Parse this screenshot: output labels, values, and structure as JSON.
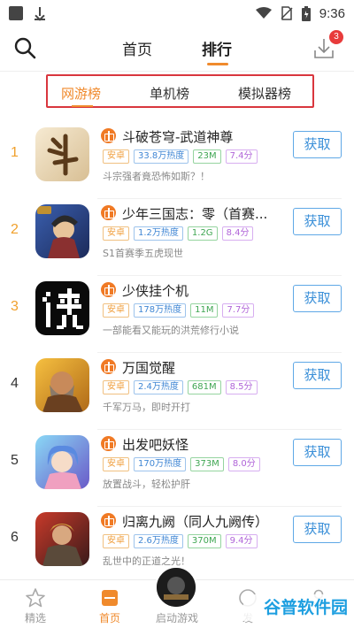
{
  "status_bar": {
    "time": "9:36",
    "icons": [
      "notification-icon",
      "download-icon",
      "wifi-icon",
      "no-sim-icon",
      "battery-icon"
    ]
  },
  "header": {
    "tabs": [
      {
        "label": "首页",
        "active": false
      },
      {
        "label": "排行",
        "active": true
      }
    ],
    "download_badge": "3",
    "accent_color": "#f08a2c"
  },
  "sub_tabs": [
    {
      "label": "网游榜",
      "active": true
    },
    {
      "label": "单机榜",
      "active": false
    },
    {
      "label": "模拟器榜",
      "active": false
    }
  ],
  "games": [
    {
      "rank": "1",
      "name": "斗破苍穹-武道神尊",
      "platform": "安卓",
      "heat": "33.8万热度",
      "size": "23M",
      "score": "7.4分",
      "desc": "斗宗强者竟恐怖如斯？！",
      "button": "获取",
      "icon": "dou-icon"
    },
    {
      "rank": "2",
      "name": "少年三国志：零（首赛...",
      "platform": "安卓",
      "heat": "1.2万热度",
      "size": "1.2G",
      "score": "8.4分",
      "desc": "S1首赛季五虎现世",
      "button": "获取",
      "icon": "warrior-icon"
    },
    {
      "rank": "3",
      "name": "少侠挂个机",
      "platform": "安卓",
      "heat": "178万热度",
      "size": "11M",
      "score": "7.7分",
      "desc": "一部能看又能玩的洪荒修行小说",
      "button": "获取",
      "icon": "xia-icon"
    },
    {
      "rank": "4",
      "name": "万国觉醒",
      "platform": "安卓",
      "heat": "2.4万热度",
      "size": "681M",
      "score": "8.5分",
      "desc": "千军万马，即时开打",
      "button": "获取",
      "icon": "general-icon"
    },
    {
      "rank": "5",
      "name": "出发吧妖怪",
      "platform": "安卓",
      "heat": "170万热度",
      "size": "373M",
      "score": "8.0分",
      "desc": "放置战斗，轻松护肝",
      "button": "获取",
      "icon": "fairy-icon"
    },
    {
      "rank": "6",
      "name": "归离九阙（同人九阙传）",
      "platform": "安卓",
      "heat": "2.6万热度",
      "size": "370M",
      "score": "9.4分",
      "desc": "乱世中的正道之光！",
      "button": "获取",
      "icon": "knight-icon"
    }
  ],
  "bottom_nav": [
    {
      "label": "精选",
      "icon": "star-icon",
      "active": false
    },
    {
      "label": "首页",
      "icon": "home-icon",
      "active": true
    },
    {
      "label": "启动游戏",
      "icon": "launch-game-icon",
      "active": false
    },
    {
      "label": "发",
      "icon": "discover-icon",
      "active": false
    },
    {
      "label": "",
      "icon": "profile-icon",
      "active": false
    }
  ],
  "watermark": "谷普软件园"
}
